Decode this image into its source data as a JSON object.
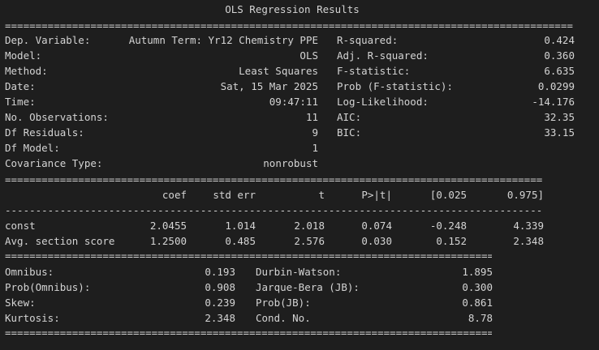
{
  "title": "OLS Regression Results",
  "top_left": [
    {
      "label": "Dep. Variable:",
      "value": "Autumn Term: Yr12 Chemistry PPE"
    },
    {
      "label": "Model:",
      "value": "OLS"
    },
    {
      "label": "Method:",
      "value": "Least Squares"
    },
    {
      "label": "Date:",
      "value": "Sat, 15 Mar 2025"
    },
    {
      "label": "Time:",
      "value": "09:47:11"
    },
    {
      "label": "No. Observations:",
      "value": "11"
    },
    {
      "label": "Df Residuals:",
      "value": "9"
    },
    {
      "label": "Df Model:",
      "value": "1"
    },
    {
      "label": "Covariance Type:",
      "value": "nonrobust"
    }
  ],
  "top_right": [
    {
      "label": "R-squared:",
      "value": "0.424"
    },
    {
      "label": "Adj. R-squared:",
      "value": "0.360"
    },
    {
      "label": "F-statistic:",
      "value": "6.635"
    },
    {
      "label": "Prob (F-statistic):",
      "value": "0.0299"
    },
    {
      "label": "Log-Likelihood:",
      "value": "-14.176"
    },
    {
      "label": "AIC:",
      "value": "32.35"
    },
    {
      "label": "BIC:",
      "value": "33.15"
    }
  ],
  "coef_headers": [
    "coef",
    "std err",
    "t",
    "P>|t|",
    "[0.025",
    "0.975]"
  ],
  "coef_rows": [
    {
      "name": "const",
      "values": [
        "2.0455",
        "1.014",
        "2.018",
        "0.074",
        "-0.248",
        "4.339"
      ]
    },
    {
      "name": "Avg. section score",
      "values": [
        "1.2500",
        "0.485",
        "2.576",
        "0.030",
        "0.152",
        "2.348"
      ]
    }
  ],
  "diag_left": [
    {
      "label": "Omnibus:",
      "value": "0.193"
    },
    {
      "label": "Prob(Omnibus):",
      "value": "0.908"
    },
    {
      "label": "Skew:",
      "value": "0.239"
    },
    {
      "label": "Kurtosis:",
      "value": "2.348"
    }
  ],
  "diag_right": [
    {
      "label": "Durbin-Watson:",
      "value": "1.895"
    },
    {
      "label": "Jarque-Bera (JB):",
      "value": "0.300"
    },
    {
      "label": "Prob(JB):",
      "value": "0.861"
    },
    {
      "label": "Cond. No.",
      "value": "8.78"
    }
  ]
}
